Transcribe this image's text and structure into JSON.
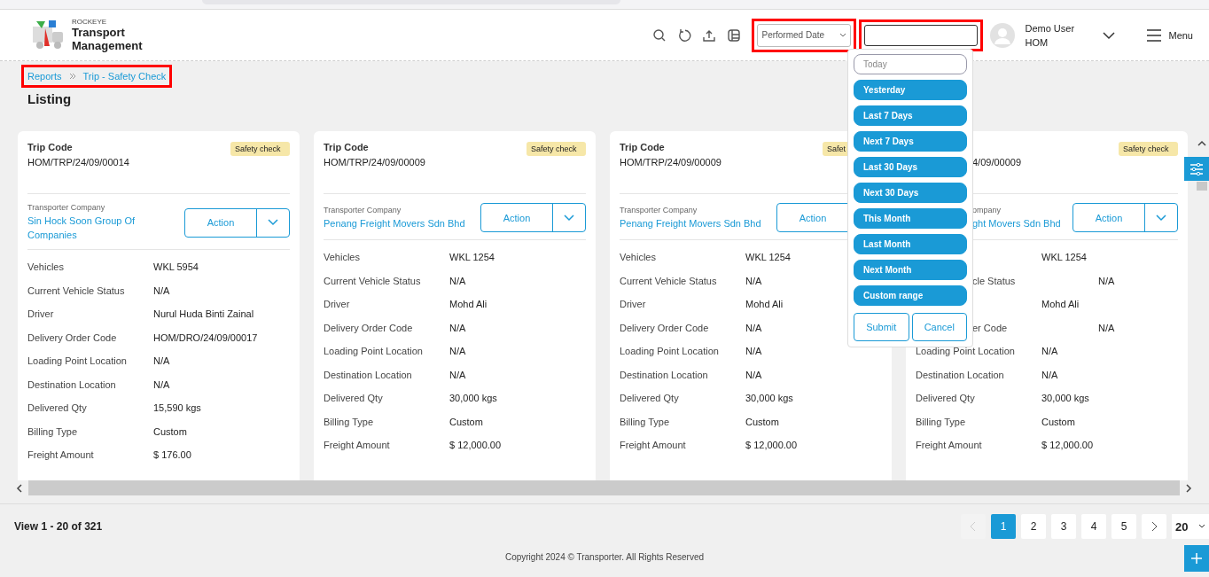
{
  "header": {
    "brand": "ROCKEYE",
    "title_lines": [
      "Transport",
      "Management"
    ],
    "date_type": "Performed Date",
    "user": {
      "name": "Demo User",
      "org": "HOM"
    },
    "menu_label": "Menu"
  },
  "date_menu": {
    "options": [
      {
        "label": "Today",
        "kind": "outlined"
      },
      {
        "label": "Yesterday",
        "kind": "filled"
      },
      {
        "label": "Last 7 Days",
        "kind": "filled"
      },
      {
        "label": "Next 7 Days",
        "kind": "filled"
      },
      {
        "label": "Last 30 Days",
        "kind": "filled"
      },
      {
        "label": "Next 30 Days",
        "kind": "filled"
      },
      {
        "label": "This Month",
        "kind": "filled"
      },
      {
        "label": "Last Month",
        "kind": "filled"
      },
      {
        "label": "Next Month",
        "kind": "filled"
      },
      {
        "label": "Custom range",
        "kind": "filled"
      }
    ],
    "buttons": [
      "Submit",
      "Cancel"
    ]
  },
  "breadcrumb": [
    "Reports",
    "Trip - Safety Check"
  ],
  "page_title": "Listing",
  "cards": [
    {
      "trip_code_label": "Trip Code",
      "trip_code": "HOM/TRP/24/09/00014",
      "badge": "Safety check",
      "company_label": "Transporter Company",
      "company": "Sin Hock Soon Group Of Companies",
      "action": "Action",
      "rows": [
        {
          "label": "Vehicles",
          "value": "WKL 5954"
        },
        {
          "label": "Current Vehicle Status",
          "value": "N/A"
        },
        {
          "label": "Driver",
          "value": "Nurul Huda Binti Zainal"
        },
        {
          "label": "Delivery Order Code",
          "value": "HOM/DRO/24/09/00017"
        },
        {
          "label": "Loading Point Location",
          "value": "N/A"
        },
        {
          "label": "Destination Location",
          "value": "N/A"
        },
        {
          "label": "Delivered Qty",
          "value": "15,590 kgs"
        },
        {
          "label": "Billing Type",
          "value": "Custom"
        },
        {
          "label": "Freight Amount",
          "value": "$ 176.00"
        }
      ]
    },
    {
      "trip_code_label": "Trip Code",
      "trip_code": "HOM/TRP/24/09/00009",
      "badge": "Safety check",
      "company_label": "Transporter Company",
      "company": "Penang Freight Movers Sdn Bhd",
      "action": "Action",
      "rows": [
        {
          "label": "Vehicles",
          "value": "WKL 1254"
        },
        {
          "label": "Current Vehicle Status",
          "value": "N/A"
        },
        {
          "label": "Driver",
          "value": "Mohd Ali"
        },
        {
          "label": "Delivery Order Code",
          "value": "N/A"
        },
        {
          "label": "Loading Point Location",
          "value": "N/A"
        },
        {
          "label": "Destination Location",
          "value": "N/A"
        },
        {
          "label": "Delivered Qty",
          "value": "30,000 kgs"
        },
        {
          "label": "Billing Type",
          "value": "Custom"
        },
        {
          "label": "Freight Amount",
          "value": "$ 12,000.00"
        }
      ]
    },
    {
      "trip_code_label": "Trip Code",
      "trip_code": "HOM/TRP/24/09/00009",
      "badge": "Safet",
      "company_label": "Transporter Company",
      "company": "Penang Freight Movers Sdn Bhd",
      "action": "Action",
      "action_caret_hidden": true,
      "rows": [
        {
          "label": "Vehicles",
          "value": "WKL 1254"
        },
        {
          "label": "Current Vehicle Status",
          "value": "N/A"
        },
        {
          "label": "Driver",
          "value": "Mohd Ali"
        },
        {
          "label": "Delivery Order Code",
          "value": "N/A"
        },
        {
          "label": "Loading Point Location",
          "value": "N/A"
        },
        {
          "label": "Destination Location",
          "value": "N/A"
        },
        {
          "label": "Delivered Qty",
          "value": "30,000 kgs"
        },
        {
          "label": "Billing Type",
          "value": "Custom"
        },
        {
          "label": "Freight Amount",
          "value": "$ 12,000.00"
        }
      ]
    },
    {
      "trip_code": "4/09/00009",
      "trip_code_cut": true,
      "badge": "Safety check",
      "company_label": "ompany",
      "company_label_cut": true,
      "company": "ght Movers Sdn Bhd",
      "company_cut": true,
      "action": "Action",
      "rows": [
        {
          "value": "WKL 1254"
        },
        {
          "label": "cle Status",
          "label_cut": true,
          "value": "N/A"
        },
        {
          "value": "Mohd Ali"
        },
        {
          "label": "er Code",
          "label_cut": true,
          "value": "N/A"
        },
        {
          "label": "Loading Point Location",
          "value": "N/A"
        },
        {
          "label": "Destination Location",
          "value": "N/A"
        },
        {
          "label": "Delivered Qty",
          "value": "30,000 kgs"
        },
        {
          "label": "Billing Type",
          "value": "Custom"
        },
        {
          "label": "Freight Amount",
          "value": "$ 12,000.00"
        }
      ]
    }
  ],
  "pagination": {
    "summary": "View 1 - 20 of 321",
    "prev_disabled": true,
    "pages": [
      {
        "label": "1",
        "selected": true
      },
      {
        "label": "2",
        "selected": false
      },
      {
        "label": "3",
        "selected": false
      },
      {
        "label": "4",
        "selected": false
      },
      {
        "label": "5",
        "selected": false
      }
    ],
    "page_size": "20"
  },
  "footer": "Copyright 2024 © Transporter. All Rights Reserved"
}
